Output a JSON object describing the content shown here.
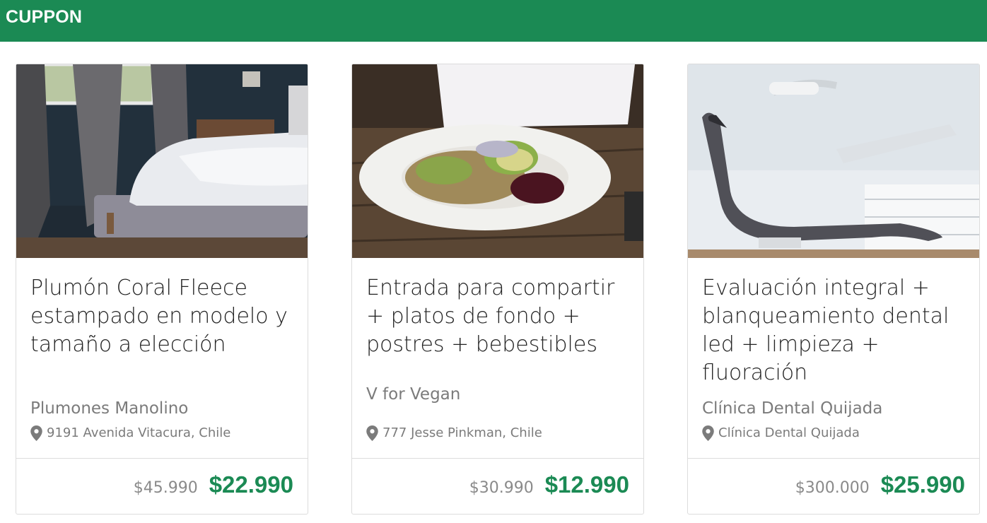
{
  "app": {
    "brand": "CUPPON"
  },
  "colors": {
    "brand": "#1b8a54",
    "muted_text": "#7b7b7b",
    "title_text": "#222222"
  },
  "deals": [
    {
      "image": "bedroom-photo",
      "title": "Plumón Coral Fleece estampado en modelo y tamaño a elección",
      "merchant": "Plumones Manolino",
      "address": "9191 Avenida Vitacura, Chile",
      "old_price": "$45.990",
      "new_price": "$22.990"
    },
    {
      "image": "salad-plate-photo",
      "title": "Entrada para compartir + platos de fondo + postres + bebestibles",
      "merchant": "V for Vegan",
      "address": "777 Jesse Pinkman, Chile",
      "old_price": "$30.990",
      "new_price": "$12.990"
    },
    {
      "image": "dental-chair-photo",
      "title": "Evaluación integral + blanqueamiento dental led + limpieza + fluoración",
      "merchant": "Clínica Dental Quijada",
      "address": "Clínica Dental Quijada",
      "old_price": "$300.000",
      "new_price": "$25.990"
    }
  ],
  "icons": {
    "location": "map-pin-icon"
  }
}
